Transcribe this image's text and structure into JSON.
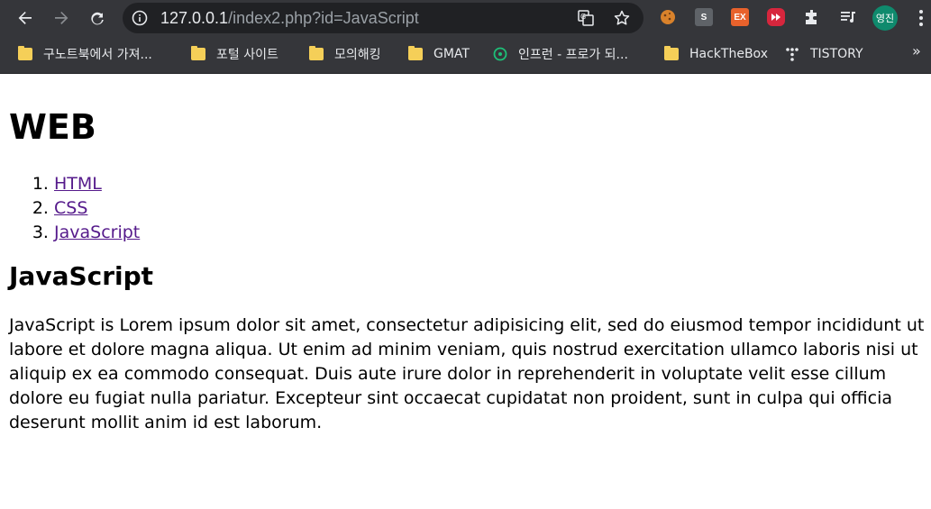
{
  "browser": {
    "url_host": "127.0.0.1",
    "url_path": "/index2.php?id=JavaScript",
    "profile_initials": "영진",
    "extensions": [
      {
        "name": "cookie-extension-icon",
        "color": "#d9822b",
        "label": ""
      },
      {
        "name": "s-extension-icon",
        "color": "#5f6368",
        "label": "S"
      },
      {
        "name": "ex-extension-icon",
        "color": "#e8622c",
        "label": "EX"
      },
      {
        "name": "youtube-extension-icon",
        "color": "#d7263d",
        "label": ""
      }
    ],
    "bookmarks": [
      {
        "label": "구노트북에서 가져...",
        "icon": "folder-icon"
      },
      {
        "label": "포털 사이트",
        "icon": "folder-icon"
      },
      {
        "label": "모의해킹",
        "icon": "folder-icon"
      },
      {
        "label": "GMAT",
        "icon": "folder-icon"
      },
      {
        "label": "인프런 - 프로가 되...",
        "icon": "inflearn-icon"
      },
      {
        "label": "HackTheBox",
        "icon": "folder-icon"
      },
      {
        "label": "TISTORY",
        "icon": "tistory-icon"
      }
    ],
    "bookmarks_overflow": "»"
  },
  "page": {
    "site_title": "WEB",
    "nav": [
      {
        "label": "HTML"
      },
      {
        "label": "CSS"
      },
      {
        "label": "JavaScript"
      }
    ],
    "heading": "JavaScript",
    "body": "JavaScript is Lorem ipsum dolor sit amet, consectetur adipisicing elit, sed do eiusmod tempor incididunt ut labore et dolore magna aliqua. Ut enim ad minim veniam, quis nostrud exercitation ullamco laboris nisi ut aliquip ex ea commodo consequat. Duis aute irure dolor in reprehenderit in voluptate velit esse cillum dolore eu fugiat nulla pariatur. Excepteur sint occaecat cupidatat non proident, sunt in culpa qui officia deserunt mollit anim id est laborum."
  }
}
